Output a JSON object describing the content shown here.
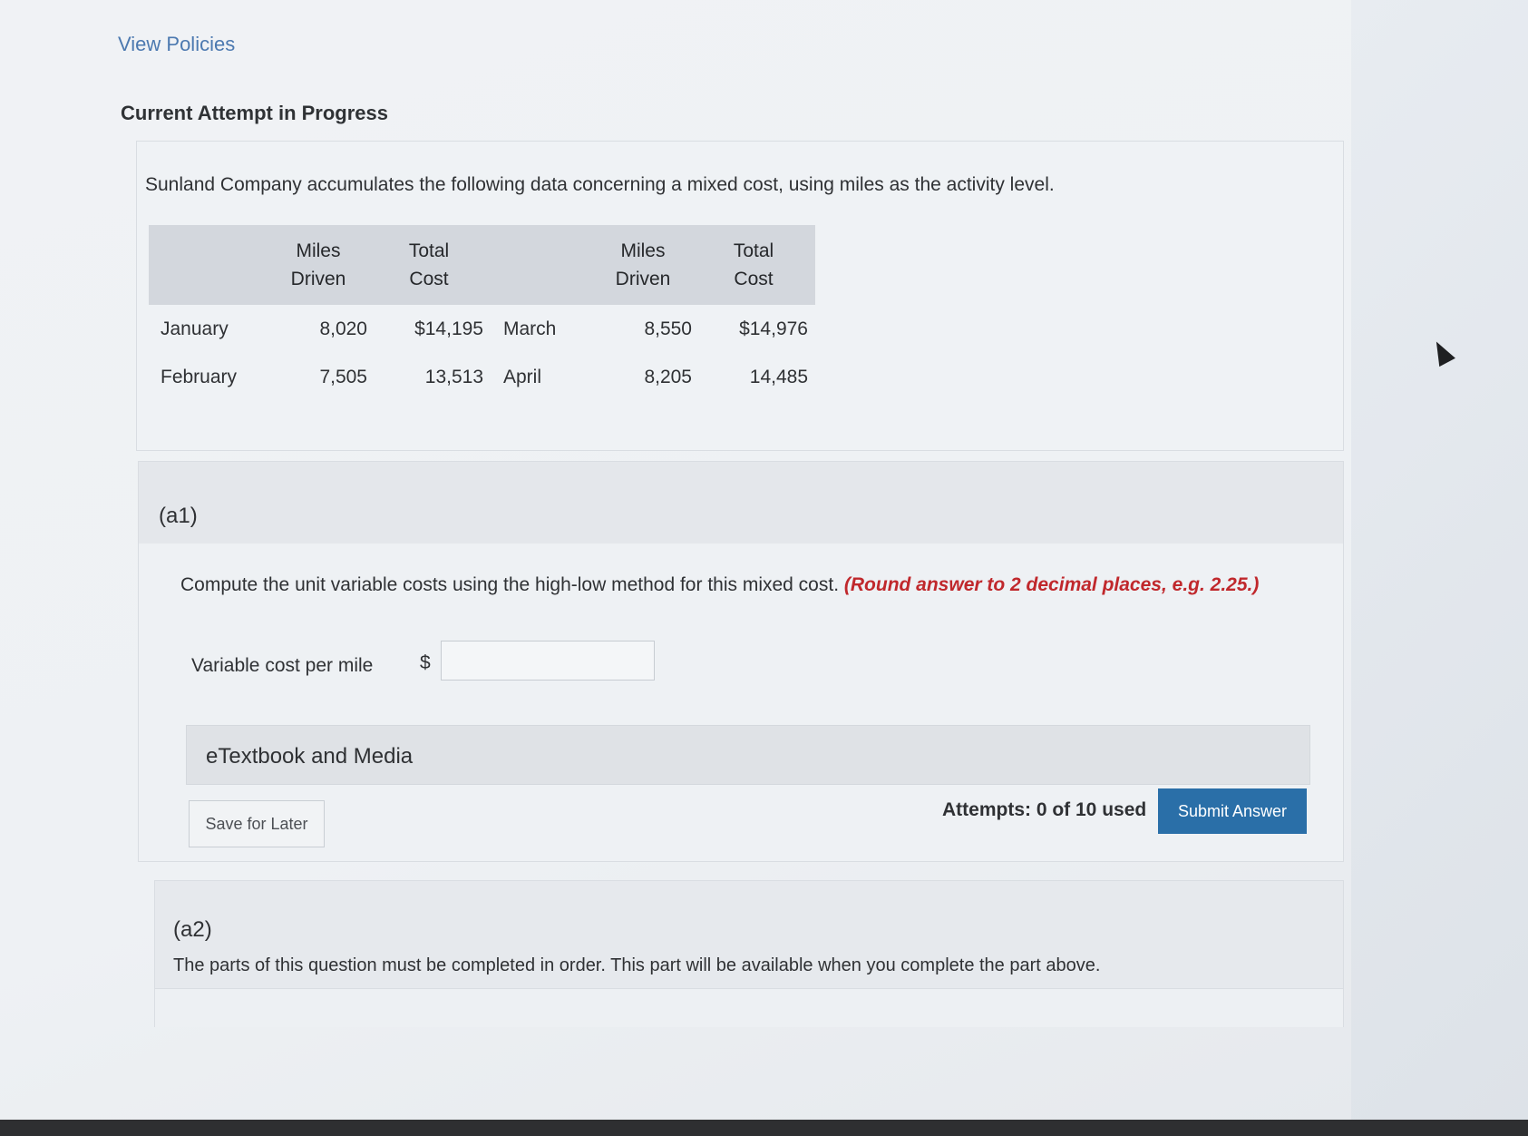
{
  "header": {
    "policies_link": "View Policies",
    "section_title": "Current Attempt in Progress"
  },
  "question": {
    "intro": "Sunland Company accumulates the following data concerning a mixed cost, using miles as the activity level.",
    "table": {
      "headers": [
        {
          "line1": "",
          "line2": ""
        },
        {
          "line1": "Miles",
          "line2": "Driven"
        },
        {
          "line1": "Total",
          "line2": "Cost"
        },
        {
          "line1": "",
          "line2": ""
        },
        {
          "line1": "Miles",
          "line2": "Driven"
        },
        {
          "line1": "Total",
          "line2": "Cost"
        }
      ],
      "rows": [
        [
          "January",
          "8,020",
          "$14,195",
          "March",
          "8,550",
          "$14,976"
        ],
        [
          "February",
          "7,505",
          "13,513",
          "April",
          "8,205",
          "14,485"
        ]
      ]
    }
  },
  "part_a1": {
    "label": "(a1)",
    "instruction": "Compute the unit variable costs using the high-low method for this mixed cost.",
    "hint": "(Round answer to 2 decimal places, e.g. 2.25.)",
    "field_label": "Variable cost per mile",
    "currency": "$",
    "input_value": "",
    "etextbook": "eTextbook and Media",
    "save_label": "Save for Later",
    "attempts": "Attempts: 0 of 10 used",
    "submit_label": "Submit Answer"
  },
  "part_a2": {
    "label": "(a2)",
    "message": "The parts of this question must be completed in order. This part will be available when you complete the part above."
  },
  "colors": {
    "link": "#4c79b0",
    "hint": "#c0282c",
    "submit": "#2a6fa8"
  },
  "icons": {
    "cursor": "mouse-cursor-icon"
  }
}
